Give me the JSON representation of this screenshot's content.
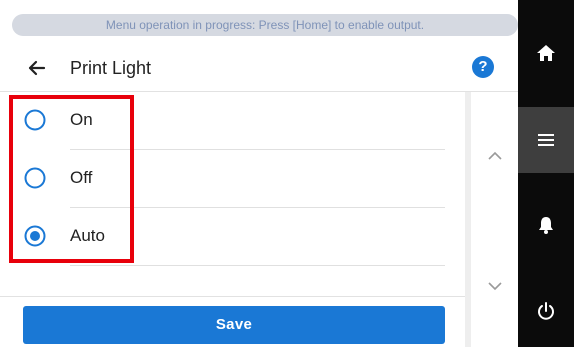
{
  "banner": {
    "message": "Menu operation in progress: Press [Home] to enable output."
  },
  "header": {
    "title": "Print Light",
    "back_icon": "arrow-left-icon",
    "help_icon": "help-icon",
    "help_glyph": "?"
  },
  "options": [
    {
      "label": "On",
      "selected": false
    },
    {
      "label": "Off",
      "selected": false
    },
    {
      "label": "Auto",
      "selected": true
    }
  ],
  "footer": {
    "save_label": "Save"
  },
  "sidebar": {
    "items": [
      {
        "icon": "home-icon",
        "active": false
      },
      {
        "icon": "menu-icon",
        "active": true
      },
      {
        "icon": "bell-icon",
        "active": false
      },
      {
        "icon": "power-icon",
        "active": false
      }
    ]
  },
  "colors": {
    "accent": "#1a78d5",
    "highlight": "#e8000b",
    "banner_bg": "#d5d9e1",
    "banner_text": "#7f93b8",
    "sidebar_bg": "#0b0b0b",
    "sidebar_active": "#3e3e3e"
  }
}
